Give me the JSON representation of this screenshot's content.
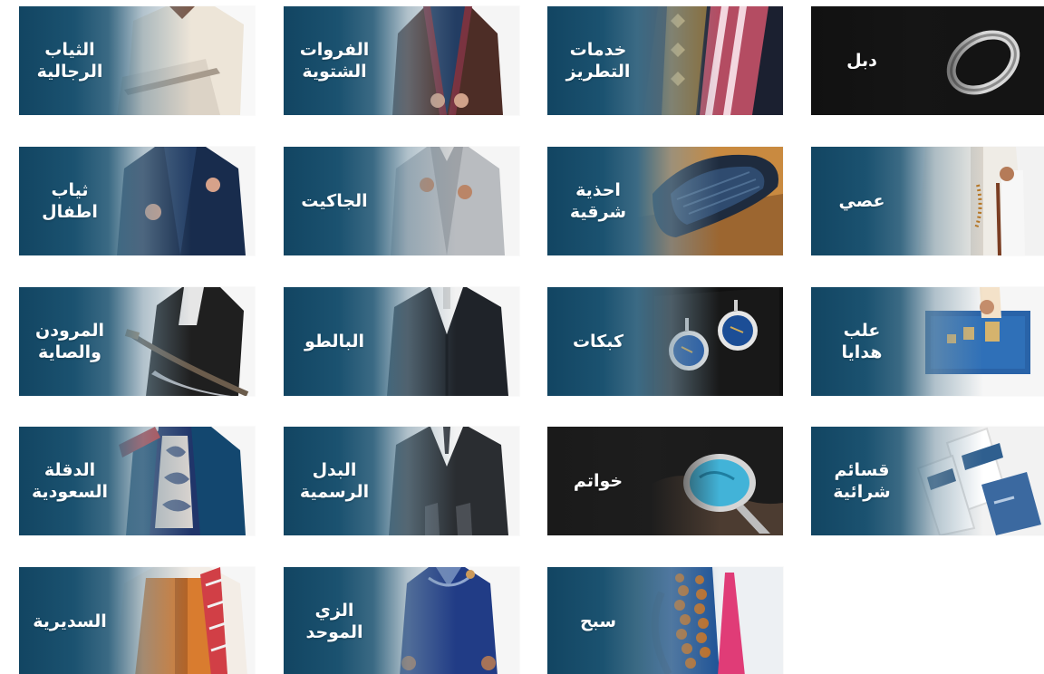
{
  "categories": [
    {
      "label": "دبل"
    },
    {
      "label": "خدمات\nالتطريز"
    },
    {
      "label": "الفروات\nالشتوية"
    },
    {
      "label": "الثياب\nالرجالية"
    },
    {
      "label": "عصي"
    },
    {
      "label": "احذية\nشرقية"
    },
    {
      "label": "الجاكيت"
    },
    {
      "label": "ثياب\nاطفال"
    },
    {
      "label": "علب\nهدايا"
    },
    {
      "label": "كبكات"
    },
    {
      "label": "البالطو"
    },
    {
      "label": "المرودن\nوالصاية"
    },
    {
      "label": "قسائم\nشرائية"
    },
    {
      "label": "خواتم"
    },
    {
      "label": "البدل\nالرسمية"
    },
    {
      "label": "الدقلة\nالسعودية"
    },
    {
      "label": "سبح"
    },
    {
      "label": "الزي\nالموحد"
    },
    {
      "label": "السديرية"
    }
  ]
}
